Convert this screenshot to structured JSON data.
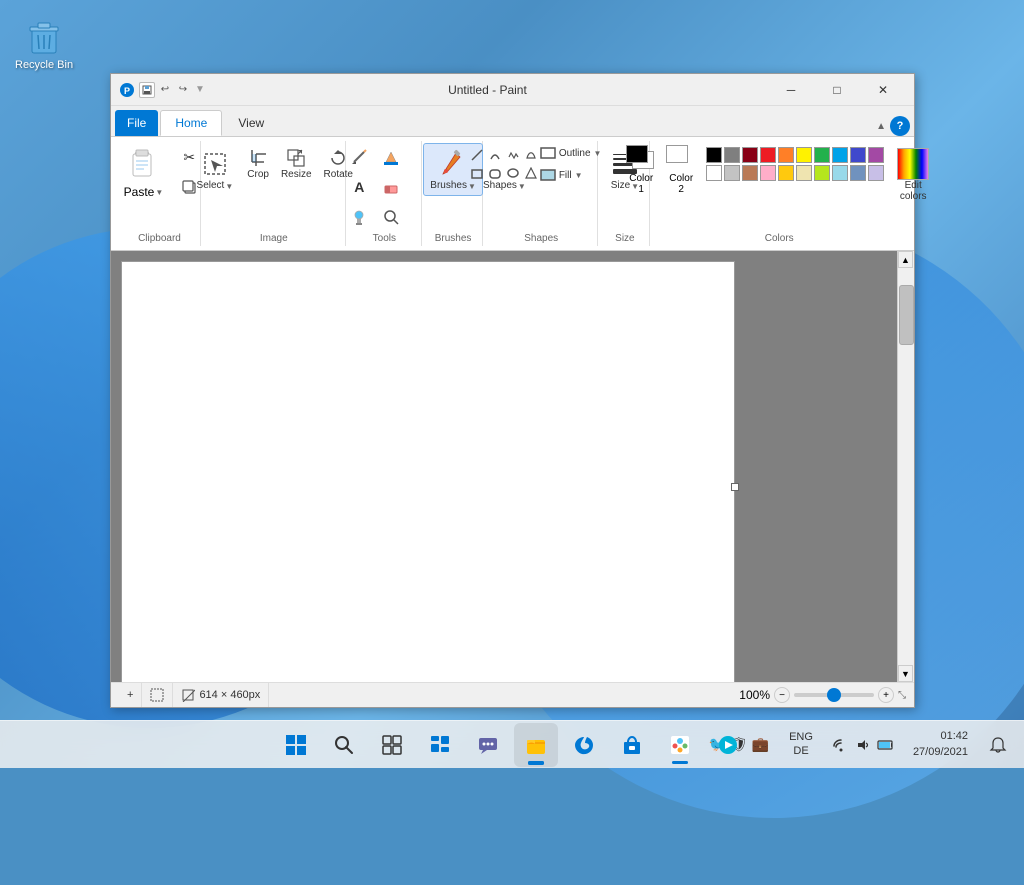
{
  "desktop": {
    "recycle_bin_label": "Recycle Bin"
  },
  "window": {
    "title": "Untitled - Paint",
    "min_btn": "─",
    "max_btn": "□",
    "close_btn": "✕"
  },
  "ribbon": {
    "tabs": [
      {
        "id": "file",
        "label": "File"
      },
      {
        "id": "home",
        "label": "Home"
      },
      {
        "id": "view",
        "label": "View"
      }
    ],
    "active_tab": "home",
    "groups": {
      "clipboard": {
        "label": "Clipboard",
        "paste_label": "Paste"
      },
      "image": {
        "label": "Image",
        "select_label": "Select",
        "crop_label": "Crop",
        "resize_label": "Resize"
      },
      "tools": {
        "label": "Tools"
      },
      "brushes": {
        "label": "Brushes"
      },
      "shapes": {
        "label": "Shapes",
        "shapes_label": "Shapes",
        "outline_label": "Outline",
        "fill_label": "Fill"
      },
      "size": {
        "label": "Size"
      },
      "colors": {
        "label": "Colors",
        "color1_label": "Color\n1",
        "color2_label": "Color\n2",
        "edit_label": "Edit\ncolors"
      }
    }
  },
  "status": {
    "add_icon": "+",
    "canvas_size": "614 × 460px",
    "zoom_pct": "100%"
  },
  "taskbar": {
    "start_icon": "⊞",
    "search_icon": "🔍",
    "task_view_icon": "❑",
    "widgets_icon": "⊡",
    "chat_icon": "💬",
    "explorer_icon": "📁",
    "edge_icon": "🌐",
    "store_icon": "🛍",
    "paint_icon": "🎨",
    "twitter_icon": "🐦",
    "lang": "ENG\nDE",
    "time": "01:42",
    "date": "27/09/2021"
  },
  "colors": {
    "row1": [
      "#000000",
      "#7f7f7f",
      "#880015",
      "#ed1c24",
      "#ff7f27",
      "#fff200",
      "#22b14c",
      "#00a2e8",
      "#3f48cc",
      "#a349a4"
    ],
    "row2": [
      "#ffffff",
      "#c3c3c3",
      "#b97a57",
      "#ffaec9",
      "#ffc90e",
      "#efe4b0",
      "#b5e61d",
      "#99d9ea",
      "#7092be",
      "#c8bfe7"
    ],
    "special": "rainbow",
    "color1_bg": "#000000",
    "color2_bg": "#ffffff"
  }
}
